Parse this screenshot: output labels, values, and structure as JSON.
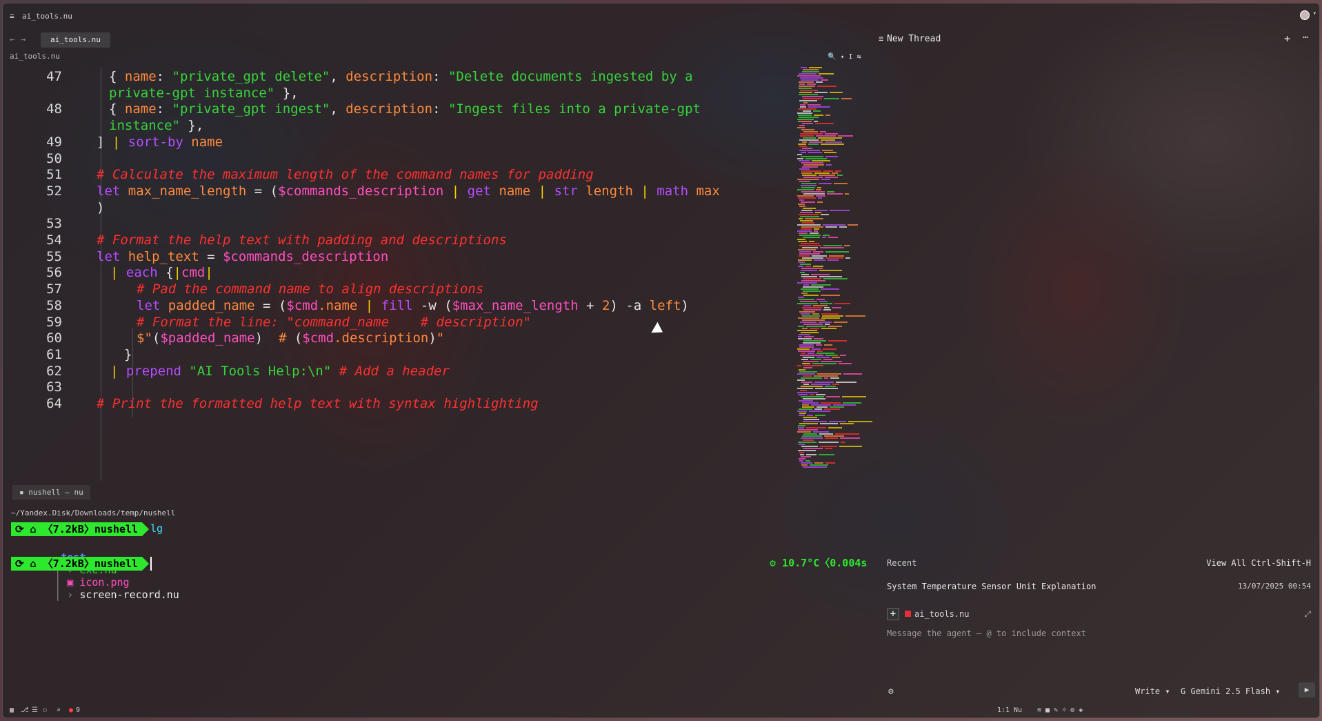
{
  "window": {
    "title": "ai_tools.nu"
  },
  "tabbar": {
    "back_glyph": "←",
    "forward_glyph": "→",
    "active_tab": "ai_tools.nu"
  },
  "breadcrumb": "ai_tools.nu",
  "editor": {
    "lines": [
      {
        "num": "47",
        "tokens": [
          [
            "c-white",
            "{ "
          ],
          [
            "c-orange",
            "name"
          ],
          [
            "c-white",
            ": "
          ],
          [
            "c-green",
            "\"private_gpt delete\""
          ],
          [
            "c-white",
            ", "
          ],
          [
            "c-orange",
            "description"
          ],
          [
            "c-white",
            ": "
          ],
          [
            "c-green",
            "\"Delete documents ingested by a"
          ]
        ]
      },
      {
        "num": "",
        "tokens": [
          [
            "c-green",
            "private-gpt instance\""
          ],
          [
            "c-white",
            " },"
          ]
        ]
      },
      {
        "num": "48",
        "tokens": [
          [
            "c-white",
            "{ "
          ],
          [
            "c-orange",
            "name"
          ],
          [
            "c-white",
            ": "
          ],
          [
            "c-green",
            "\"private_gpt ingest\""
          ],
          [
            "c-white",
            ", "
          ],
          [
            "c-orange",
            "description"
          ],
          [
            "c-white",
            ": "
          ],
          [
            "c-green",
            "\"Ingest files into a private-gpt"
          ]
        ]
      },
      {
        "num": "",
        "tokens": [
          [
            "c-green",
            "instance\""
          ],
          [
            "c-white",
            " },"
          ]
        ]
      },
      {
        "num": "49",
        "tokens": [
          [
            "c-white",
            "] "
          ],
          [
            "c-yellow",
            "| "
          ],
          [
            "c-purple",
            "sort-by "
          ],
          [
            "c-orange",
            "name"
          ]
        ]
      },
      {
        "num": "50",
        "tokens": []
      },
      {
        "num": "51",
        "tokens": [
          [
            "c-red",
            "# Calculate the maximum length of the command names for padding"
          ]
        ]
      },
      {
        "num": "52",
        "tokens": [
          [
            "c-purple",
            "let "
          ],
          [
            "c-orange",
            "max_name_length"
          ],
          [
            "c-white",
            " = ("
          ],
          [
            "c-pink",
            "$commands_description"
          ],
          [
            "c-yellow",
            " | "
          ],
          [
            "c-purple",
            "get "
          ],
          [
            "c-orange",
            "name"
          ],
          [
            "c-yellow",
            " | "
          ],
          [
            "c-purple",
            "str "
          ],
          [
            "c-orange",
            "length"
          ],
          [
            "c-yellow",
            " | "
          ],
          [
            "c-purple",
            "math "
          ],
          [
            "c-orange",
            "max"
          ]
        ]
      },
      {
        "num": "",
        "tokens": [
          [
            "c-white",
            ")"
          ]
        ]
      },
      {
        "num": "53",
        "tokens": []
      },
      {
        "num": "54",
        "tokens": [
          [
            "c-red",
            "# Format the help text with padding and descriptions"
          ]
        ]
      },
      {
        "num": "55",
        "tokens": [
          [
            "c-purple",
            "let "
          ],
          [
            "c-orange",
            "help_text"
          ],
          [
            "c-white",
            " = "
          ],
          [
            "c-pink",
            "$commands_description"
          ]
        ]
      },
      {
        "num": "56",
        "tokens": [
          [
            "c-yellow",
            "| "
          ],
          [
            "c-purple",
            "each "
          ],
          [
            "c-white",
            "{"
          ],
          [
            "c-yellow",
            "|"
          ],
          [
            "c-pink",
            "cmd"
          ],
          [
            "c-yellow",
            "|"
          ]
        ]
      },
      {
        "num": "57",
        "tokens": [
          [
            "c-red",
            "# Pad the command name to align descriptions"
          ]
        ]
      },
      {
        "num": "58",
        "tokens": [
          [
            "c-purple",
            "let "
          ],
          [
            "c-orange",
            "padded_name"
          ],
          [
            "c-white",
            " = ("
          ],
          [
            "c-pink",
            "$cmd"
          ],
          [
            "c-orange",
            ".name"
          ],
          [
            "c-yellow",
            " | "
          ],
          [
            "c-purple",
            "fill "
          ],
          [
            "c-white",
            "-w ("
          ],
          [
            "c-pink",
            "$max_name_length"
          ],
          [
            "c-white",
            " + "
          ],
          [
            "c-orange",
            "2"
          ],
          [
            "c-white",
            ") -a "
          ],
          [
            "c-orange",
            "left"
          ],
          [
            "c-white",
            ")"
          ]
        ]
      },
      {
        "num": "59",
        "tokens": [
          [
            "c-red",
            "# Format the line: \"command_name    # description\""
          ]
        ]
      },
      {
        "num": "60",
        "tokens": [
          [
            "c-orange",
            "$\""
          ],
          [
            "c-white",
            "("
          ],
          [
            "c-pink",
            "$padded_name"
          ],
          [
            "c-white",
            ")"
          ],
          [
            "c-orange",
            "  # "
          ],
          [
            "c-white",
            "("
          ],
          [
            "c-pink",
            "$cmd"
          ],
          [
            "c-orange",
            ".description"
          ],
          [
            "c-white",
            ")"
          ],
          [
            "c-orange",
            "\""
          ]
        ]
      },
      {
        "num": "61",
        "tokens": [
          [
            "c-white",
            "}"
          ]
        ]
      },
      {
        "num": "62",
        "tokens": [
          [
            "c-yellow",
            "| "
          ],
          [
            "c-purple",
            "prepend "
          ],
          [
            "c-green",
            "\"AI Tools Help:\\n\""
          ],
          [
            "c-red",
            " # Add a header"
          ]
        ]
      },
      {
        "num": "63",
        "tokens": []
      },
      {
        "num": "64",
        "tokens": [
          [
            "c-red",
            "# Print the formatted help text with syntax highlighting"
          ]
        ]
      }
    ]
  },
  "minimap": {
    "toolbar": "🔍✦I⇆"
  },
  "terminal": {
    "tab_label": "nushell — nu",
    "path": "~/Yandex.Disk/Downloads/temp/nushell",
    "prompt_text": "⟳ ⌂ 〈7.2kB〉nushell",
    "command": "lg",
    "ls_items": [
      "test",
      "exe.nu",
      "icon.png",
      "screen-record.nu"
    ],
    "status": "⚙ 10.7°C〈0.004s"
  },
  "panel": {
    "title": "New Thread",
    "recent_label": "Recent",
    "view_all": "View All",
    "view_all_shortcut": "Ctrl-Shift-H",
    "thread_title": "System Temperature Sensor Unit Explanation",
    "thread_date": "13/07/2025 00:54",
    "context_file": "ai_tools.nu",
    "input_placeholder": "Message the agent — @ to include context",
    "mode": "Write",
    "model": "G Gemini 2.5 Flash"
  },
  "statusbar": {
    "problems_count": "9",
    "cursor_pos": "1:1",
    "language": "Nu"
  }
}
